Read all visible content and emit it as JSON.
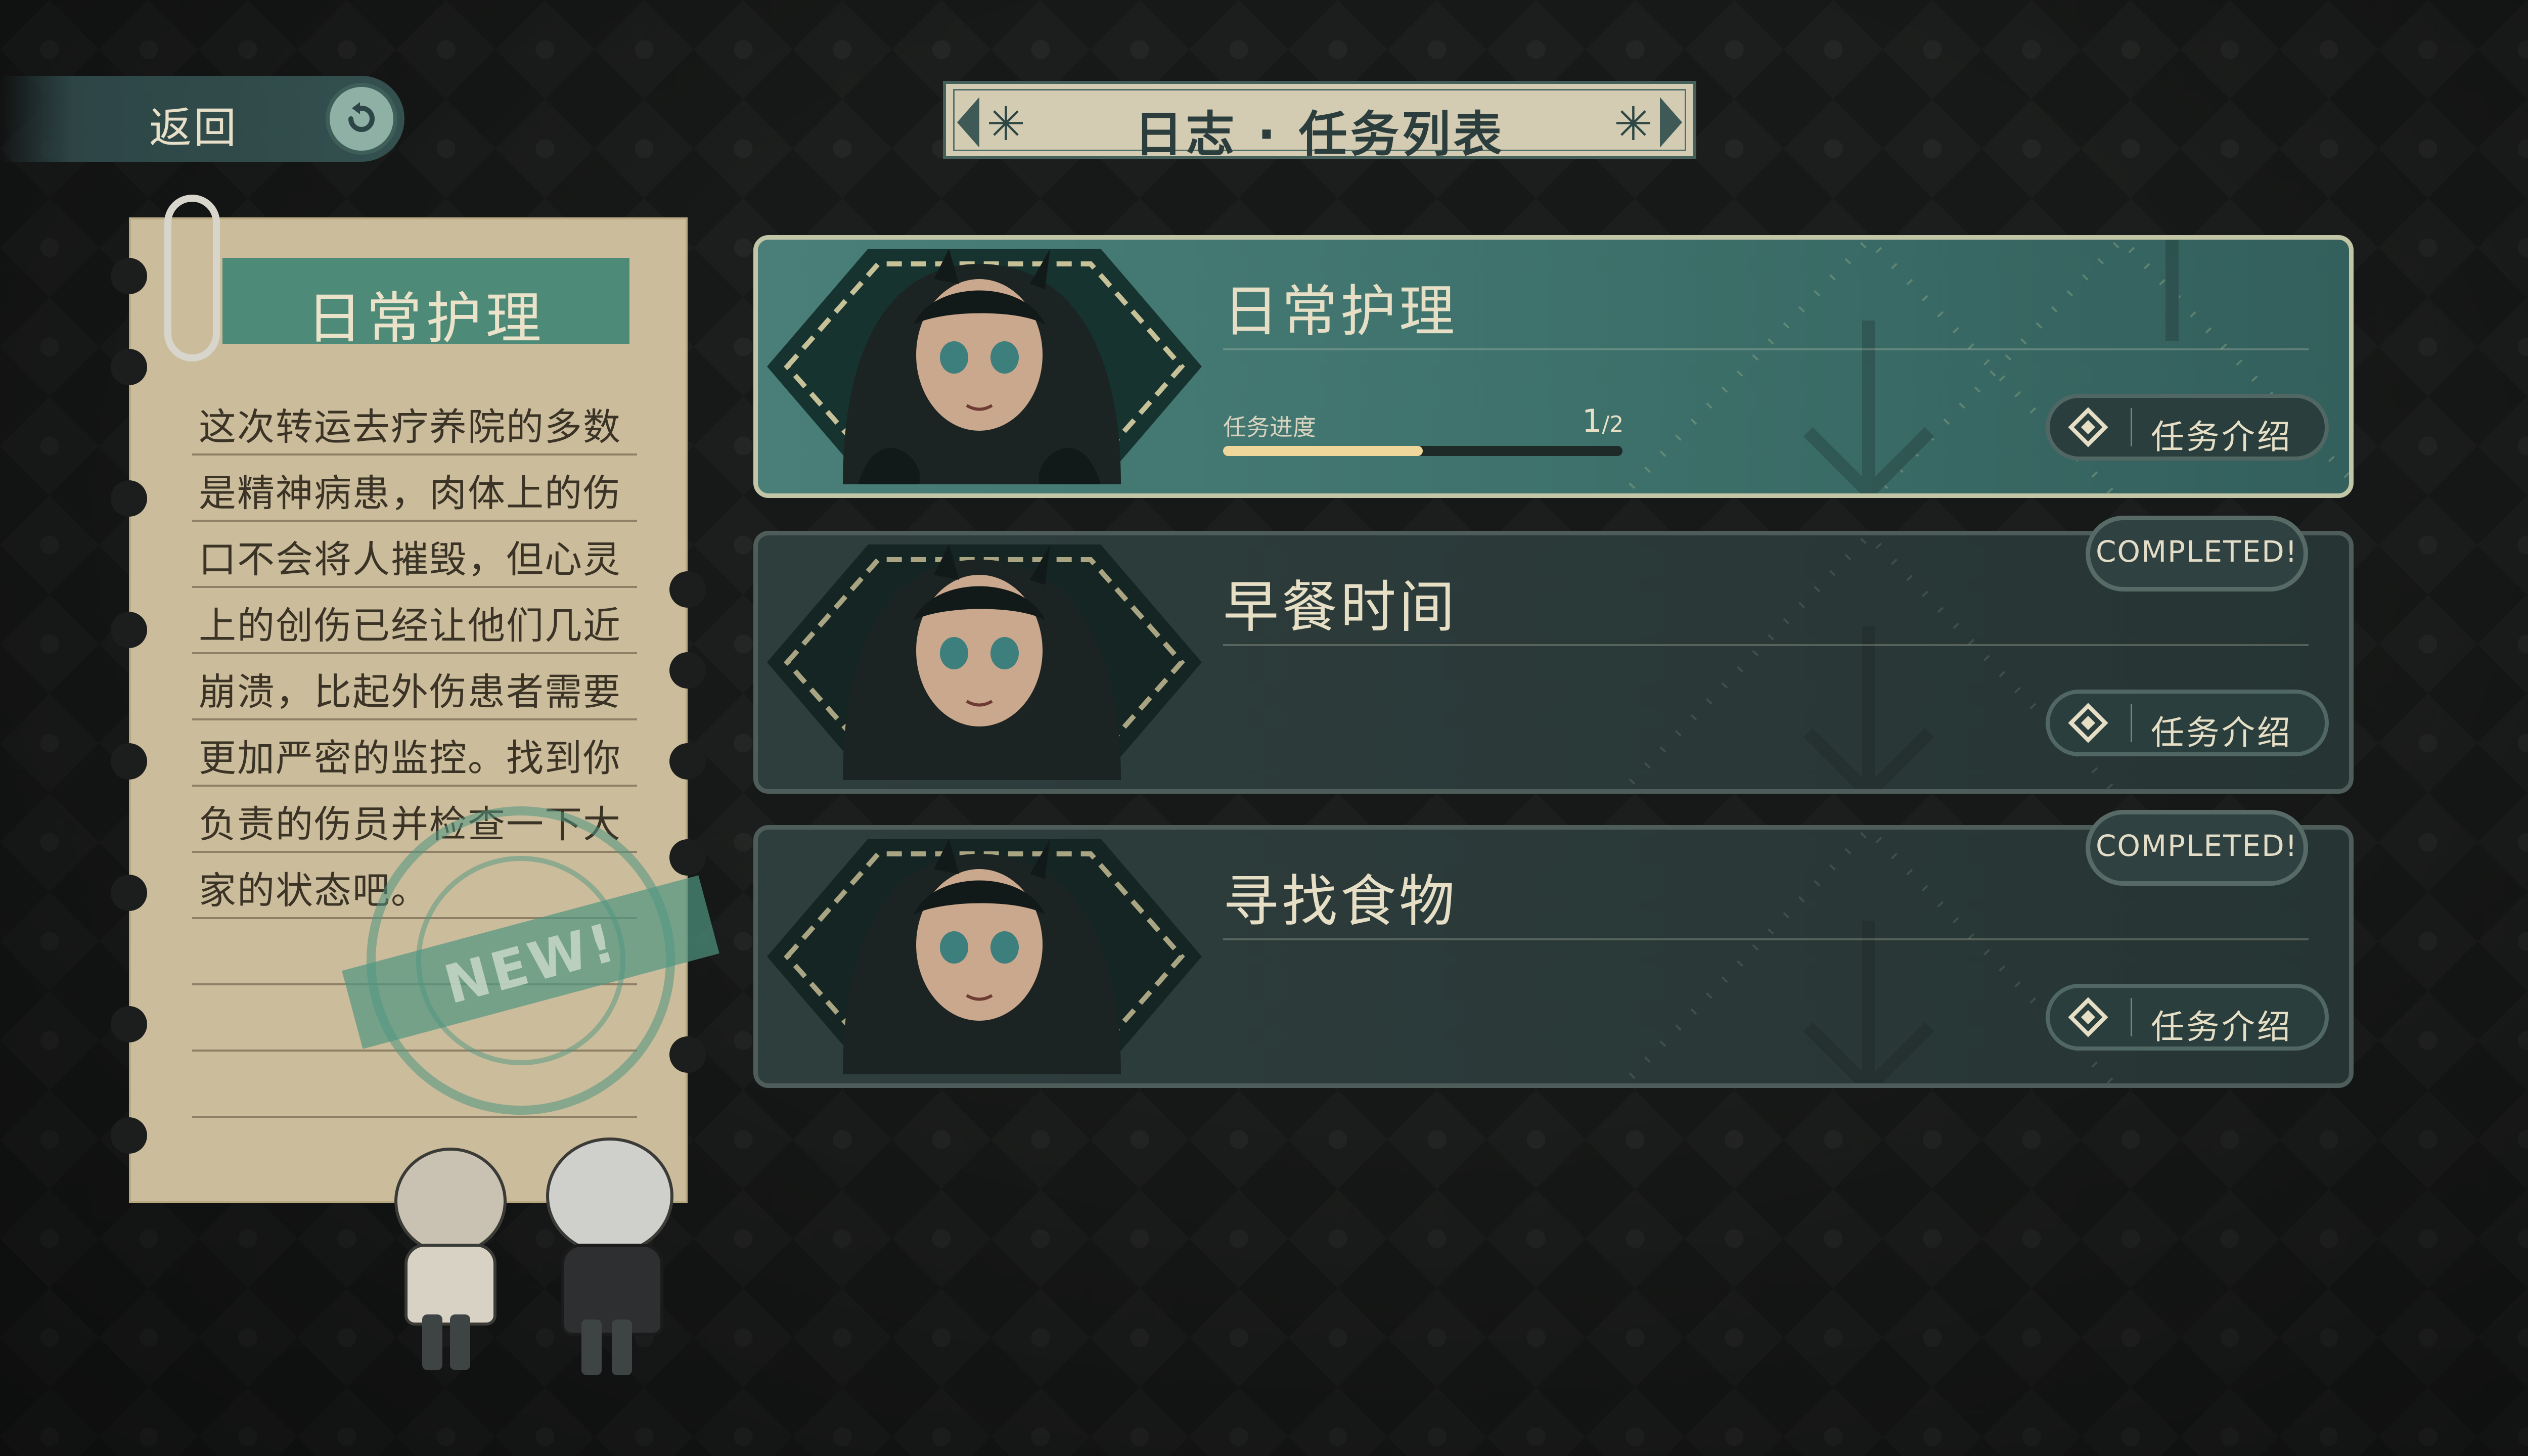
{
  "back": {
    "label": "返回"
  },
  "header": {
    "title": "日志 · 任务列表"
  },
  "note": {
    "title": "日常护理",
    "body": "这次转运去疗养院的多数是精神病患，肉体上的伤口不会将人摧毁，但心灵上的创伤已经让他们几近崩溃，比起外伤患者需要更加严密的监控。找到你负责的伤员并检查一下大家的状态吧。",
    "stamp": "NEW!"
  },
  "tasks": [
    {
      "name": "日常护理",
      "progress_label": "任务进度",
      "progress_count": "1",
      "progress_total": "/2",
      "progress_fraction": 0.5,
      "intro_label": "任务介绍",
      "status": "active"
    },
    {
      "name": "早餐时间",
      "intro_label": "任务介绍",
      "status": "completed",
      "badge": "COMPLETED!"
    },
    {
      "name": "寻找食物",
      "intro_label": "任务介绍",
      "status": "completed",
      "badge": "COMPLETED!"
    }
  ],
  "colors": {
    "accent": "#4e8a78",
    "paper": "#cbbc9b",
    "progress": "#efd79b"
  }
}
